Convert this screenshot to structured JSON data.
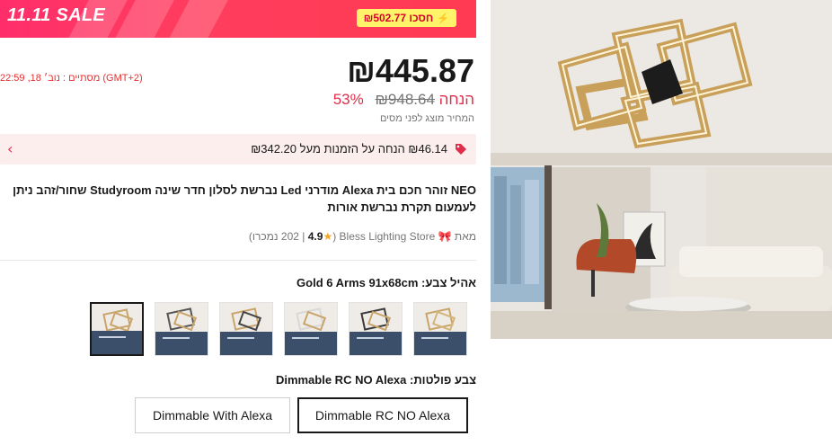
{
  "banner": {
    "sale_label": "11.11 SALE",
    "save_text": "חסכו ₪502.77"
  },
  "price": {
    "current": "₪445.87",
    "original": "₪948.64",
    "discount": "53% הנחה",
    "tax_note": "המחיר מוצג לפני מסים"
  },
  "countdown": "מסתיים : נוב׳ 18, 22:59 (GMT+2)",
  "coupon": {
    "text": "₪46.14 הנחה על הזמנות מעל ₪342.20"
  },
  "product": {
    "title": "NEO זוהר חכם בית Alexa מודרני Led נברשת לסלון חדר שינה Studyroom שחור/זהב ניתן לעמעום תקרת נברשת אורות"
  },
  "store": {
    "prefix": "מאת",
    "name": "Bless Lighting Store",
    "reviews": "202",
    "rating": "4.9",
    "sold_word": "נמכרו"
  },
  "variant_color": {
    "label": "אהיל צבע:",
    "value": "Gold 6 Arms 91x68cm",
    "selected_index": 0,
    "thumbnails_count": 6
  },
  "plug": {
    "label": "צבע פולטות:",
    "value": "Dimmable RC NO Alexa",
    "options": [
      "Dimmable RC NO Alexa",
      "Dimmable With Alexa"
    ]
  },
  "colors": {
    "accent": "#ff2e6b",
    "price_red": "#e02d4b",
    "coupon_bg": "#fdeeee",
    "highlight_yellow": "#fff36a"
  }
}
